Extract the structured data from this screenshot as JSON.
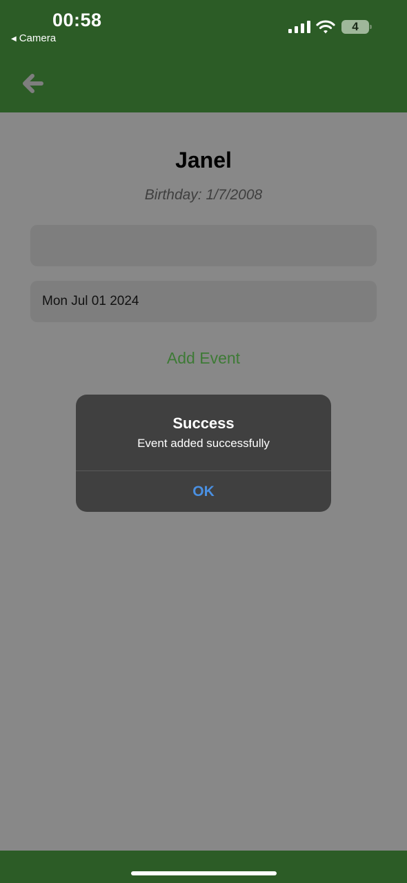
{
  "status_bar": {
    "time": "00:58",
    "back_app": "Camera",
    "battery": "4"
  },
  "header": {
    "back_icon": "arrow-left-icon",
    "color": "#2c5c26"
  },
  "person": {
    "name": "Janel",
    "birthday": "Birthday: 1/7/2008"
  },
  "form": {
    "event_name_value": "",
    "date_value": "Mon Jul 01 2024",
    "add_event_label": "Add Event"
  },
  "alert": {
    "title": "Success",
    "message": "Event added successfully",
    "ok_label": "OK"
  },
  "colors": {
    "header": "#2c5c26",
    "accent_green": "#3d7a35",
    "ok_blue": "#4a90e2",
    "overlay": "#888888"
  }
}
